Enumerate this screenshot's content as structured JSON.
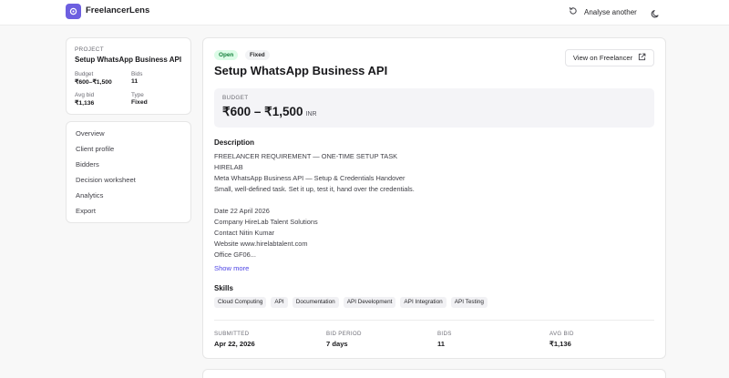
{
  "app": {
    "name": "FreelancerLens"
  },
  "header": {
    "analyse_label": "Analyse another"
  },
  "project_card": {
    "label": "PROJECT",
    "title": "Setup WhatsApp Business API",
    "budget_label": "Budget",
    "budget_value": "₹600–₹1,500",
    "bids_label": "Bids",
    "bids_value": "11",
    "avg_bid_label": "Avg bid",
    "avg_bid_value": "₹1,136",
    "type_label": "Type",
    "type_value": "Fixed"
  },
  "nav": {
    "items": [
      {
        "label": "Overview"
      },
      {
        "label": "Client profile"
      },
      {
        "label": "Bidders"
      },
      {
        "label": "Decision worksheet"
      },
      {
        "label": "Analytics"
      },
      {
        "label": "Export"
      }
    ]
  },
  "main": {
    "status_badge": "Open",
    "type_badge": "Fixed",
    "title": "Setup WhatsApp Business API",
    "view_button": "View on Freelancer",
    "budget": {
      "label": "BUDGET",
      "value": "₹600 – ₹1,500",
      "currency": "INR"
    },
    "description": {
      "heading": "Description",
      "lines": [
        "FREELANCER REQUIREMENT — ONE-TIME SETUP TASK",
        "HIRELAB",
        "Meta WhatsApp Business API — Setup & Credentials Handover",
        "Small, well-defined task. Set it up, test it, hand over the credentials.",
        "",
        "Date 22 April 2026",
        "Company HireLab Talent Solutions",
        "Contact Nitin Kumar",
        "Website www.hirelabtalent.com",
        "Office GF06..."
      ],
      "show_more": "Show more"
    },
    "skills": {
      "heading": "Skills",
      "items": [
        "Cloud Computing",
        "API",
        "Documentation",
        "API Development",
        "API Integration",
        "API Testing"
      ]
    },
    "stats": [
      {
        "label": "SUBMITTED",
        "value": "Apr 22, 2026"
      },
      {
        "label": "BID PERIOD",
        "value": "7 days"
      },
      {
        "label": "BIDS",
        "value": "11"
      },
      {
        "label": "AVG BID",
        "value": "₹1,136"
      }
    ]
  },
  "colors": {
    "accent": "#6d5fe0",
    "link": "#4f46e5",
    "open_badge_bg": "#dcfce7",
    "open_badge_text": "#15803d"
  }
}
